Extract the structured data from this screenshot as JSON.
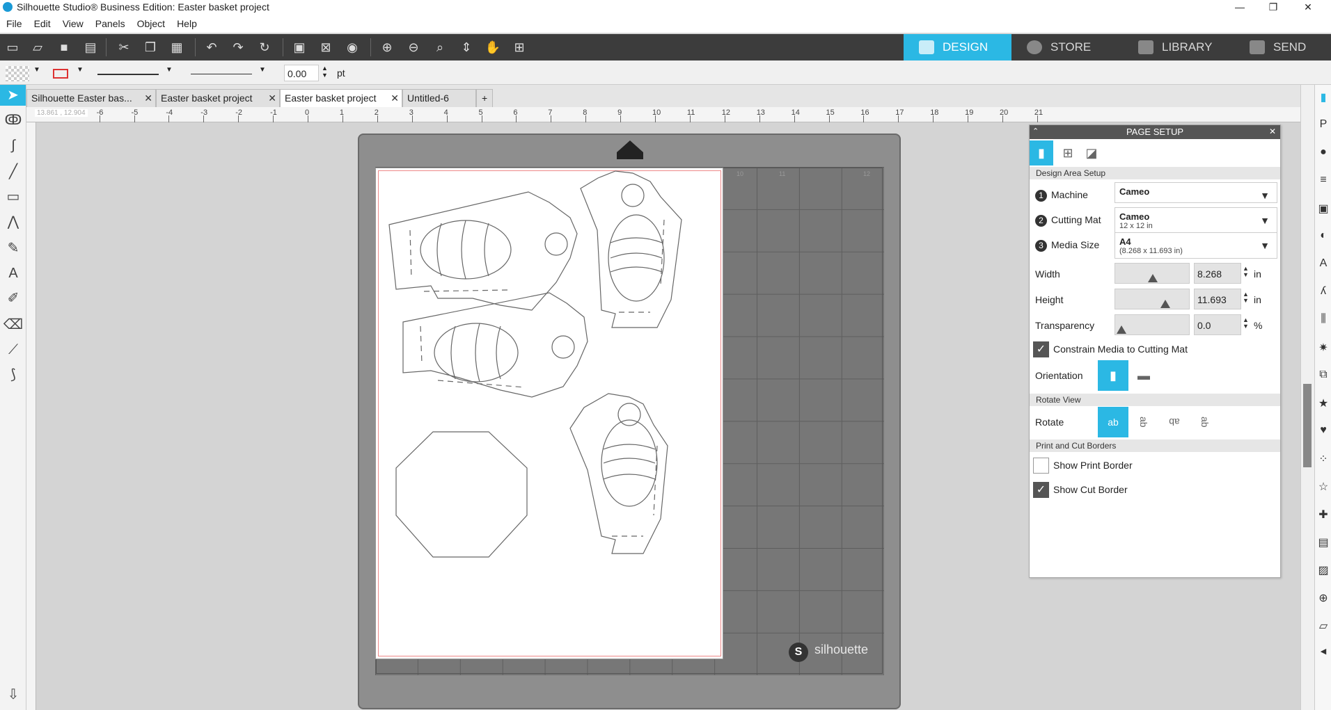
{
  "window": {
    "title": "Silhouette Studio® Business Edition: Easter basket project",
    "min": "—",
    "max": "❐",
    "close": "✕"
  },
  "menu": [
    "File",
    "Edit",
    "View",
    "Panels",
    "Object",
    "Help"
  ],
  "nav": [
    {
      "label": "DESIGN",
      "active": true
    },
    {
      "label": "STORE"
    },
    {
      "label": "LIBRARY"
    },
    {
      "label": "SEND"
    }
  ],
  "props": {
    "line_width": "0.00",
    "unit": "pt"
  },
  "tabs": [
    {
      "label": "Silhouette Easter bas...",
      "close": "✕"
    },
    {
      "label": "Easter basket project",
      "close": "✕"
    },
    {
      "label": "Easter basket project",
      "close": "✕",
      "active": true
    },
    {
      "label": "Untitled-6"
    },
    {
      "label": "+"
    }
  ],
  "ruler": {
    "coords": "13.861 , 12.904",
    "ticks": [
      "-6",
      "-5",
      "-4",
      "-3",
      "-2",
      "-1",
      "0",
      "1",
      "2",
      "3",
      "4",
      "5",
      "6",
      "7",
      "8",
      "9",
      "10",
      "11",
      "12",
      "13",
      "14",
      "15",
      "16",
      "17",
      "18",
      "19",
      "20",
      "21"
    ]
  },
  "mat": {
    "brand": "silhouette",
    "cols": [
      "10",
      "11",
      "12"
    ]
  },
  "panel": {
    "title": "PAGE SETUP",
    "section1": "Design Area Setup",
    "machine": {
      "num": "1",
      "label": "Machine",
      "value": "Cameo"
    },
    "cutting_mat": {
      "num": "2",
      "label": "Cutting Mat",
      "value": "Cameo",
      "sub": "12 x 12 in"
    },
    "media_size": {
      "num": "3",
      "label": "Media Size",
      "value": "A4",
      "sub": "(8.268 x 11.693 in)"
    },
    "width": {
      "label": "Width",
      "value": "8.268",
      "unit": "in",
      "level": 0.5
    },
    "height": {
      "label": "Height",
      "value": "11.693",
      "unit": "in",
      "level": 0.7
    },
    "transparency": {
      "label": "Transparency",
      "value": "0.0",
      "unit": "%",
      "level": 0
    },
    "constrain": {
      "label": "Constrain Media to Cutting Mat",
      "checked": true
    },
    "orientation": {
      "label": "Orientation"
    },
    "section2": "Rotate View",
    "rotate": {
      "label": "Rotate",
      "options": [
        "ab",
        "ab",
        "ab",
        "ab"
      ]
    },
    "section3": "Print and Cut Borders",
    "print_border": {
      "label": "Show Print Border",
      "checked": false
    },
    "cut_border": {
      "label": "Show Cut Border",
      "checked": true
    }
  }
}
